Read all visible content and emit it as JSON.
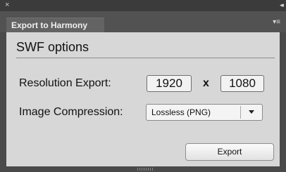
{
  "window": {
    "close_symbol": "×",
    "collapse_symbol": "◂◂"
  },
  "tab": {
    "title": "Export to Harmony",
    "menu_icon": "panel-menu-icon"
  },
  "section": {
    "title": "SWF options"
  },
  "resolution": {
    "label": "Resolution Export:",
    "width": "1920",
    "separator": "x",
    "height": "1080"
  },
  "compression": {
    "label": "Image Compression:",
    "selected": "Lossless (PNG)"
  },
  "actions": {
    "export_label": "Export"
  }
}
